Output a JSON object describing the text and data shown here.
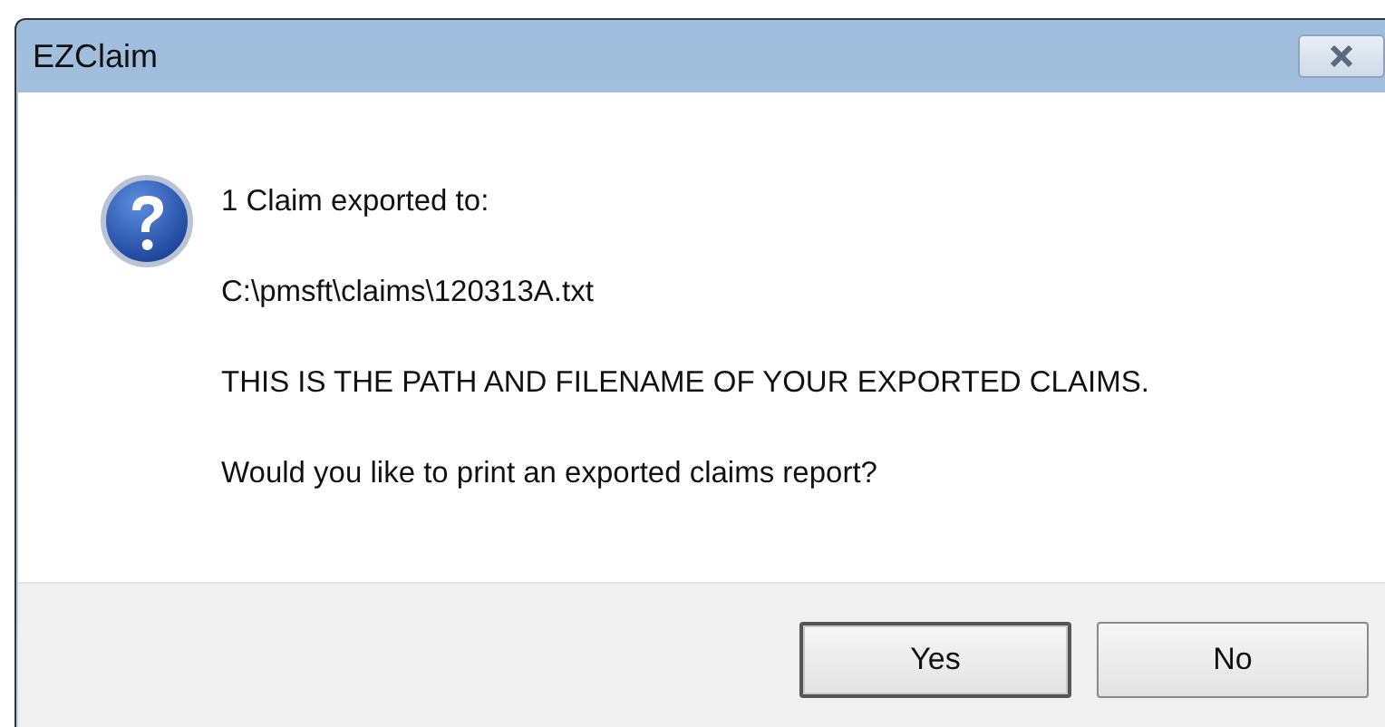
{
  "window": {
    "title": "EZClaim"
  },
  "message": {
    "lines": [
      "1 Claim exported to:",
      "C:\\pmsft\\claims\\120313A.txt",
      "THIS IS THE PATH AND FILENAME OF YOUR EXPORTED CLAIMS.",
      "Would you like to print an exported claims report?"
    ]
  },
  "buttons": [
    {
      "label": "Yes",
      "default": true
    },
    {
      "label": "No",
      "default": false
    }
  ]
}
